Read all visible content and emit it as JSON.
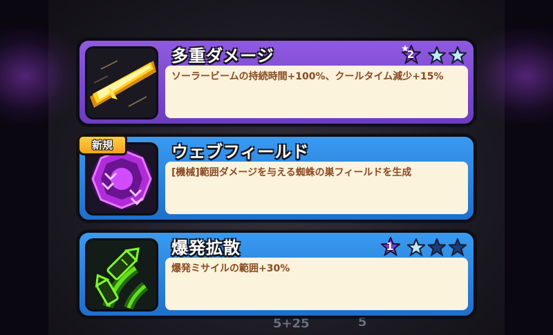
{
  "background": {
    "numbers": [
      "5+25",
      "5"
    ]
  },
  "cards": [
    {
      "title": "多重ダメージ",
      "description": "ソーラービームの持続時間+100%、クールタイム減少+15%",
      "level": "2",
      "stars_filled": 2,
      "stars_total": 2,
      "theme": "purple",
      "icon": "solar-beam-icon"
    },
    {
      "badge": "新規",
      "title": "ウェブフィールド",
      "description": "[機械]範囲ダメージを与える蜘蛛の巣フィールドを生成",
      "theme": "blue",
      "icon": "web-field-icon"
    },
    {
      "title": "爆発拡散",
      "description": "爆発ミサイルの範囲+30%",
      "level": "1",
      "stars_filled": 1,
      "stars_total": 3,
      "theme": "blue",
      "icon": "missile-icon"
    }
  ],
  "colors": {
    "purple_card": "#8f5ae0",
    "blue_card": "#3a9af0",
    "description_bg": "#fbf3dc",
    "description_text": "#8a4a22",
    "star_filled": "#bfe9ff",
    "star_empty": "#1c3f7a",
    "new_badge": "#ffcf46"
  }
}
